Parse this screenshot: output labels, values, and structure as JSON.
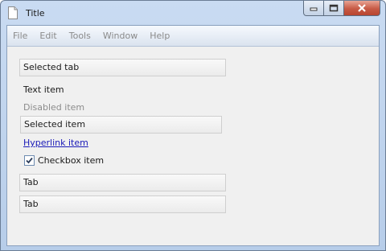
{
  "window": {
    "title": "Title"
  },
  "menu": [
    "File",
    "Edit",
    "Tools",
    "Window",
    "Help"
  ],
  "content": {
    "selected_tab": "Selected tab",
    "text_item": "Text item",
    "disabled_item": "Disabled item",
    "selected_item": "Selected item",
    "hyperlink_item": "Hyperlink item",
    "checkbox_item": {
      "label": "Checkbox item",
      "checked": true
    },
    "tab1": "Tab",
    "tab2": "Tab"
  },
  "colors": {
    "titlebar": "#c9dbf2",
    "close_button": "#c75a45",
    "client_bg": "#f0f0f0",
    "link": "#1a1ab8"
  }
}
